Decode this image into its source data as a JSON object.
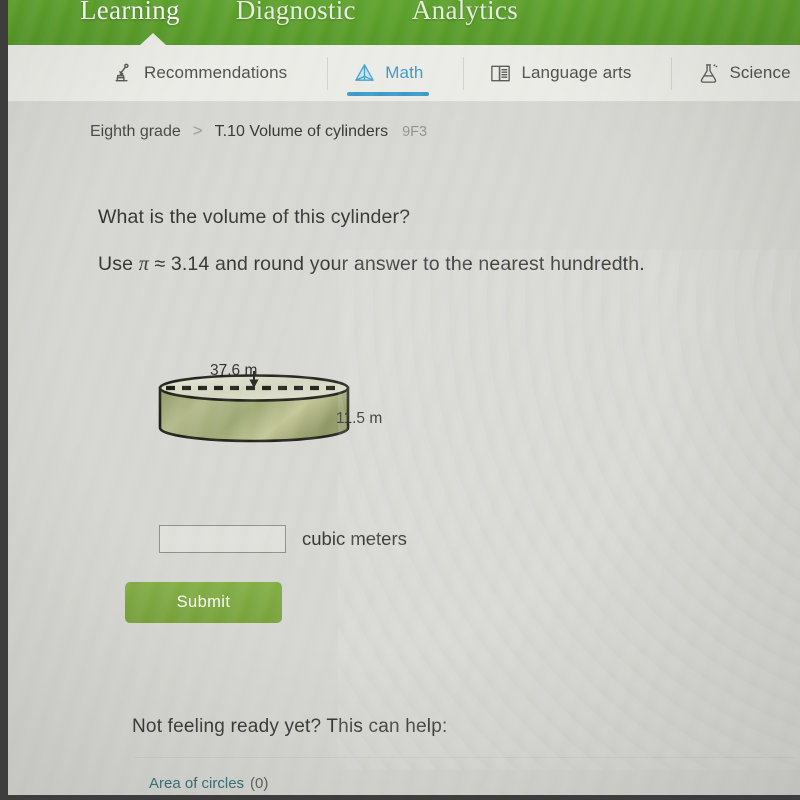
{
  "topnav": {
    "items": [
      {
        "label": "Learning",
        "active": true
      },
      {
        "label": "Diagnostic",
        "active": false
      },
      {
        "label": "Analytics",
        "active": false
      }
    ],
    "background_color": "#55a21c"
  },
  "tabs": [
    {
      "label": "Recommendations",
      "icon": "microscope-icon",
      "active": false
    },
    {
      "label": "Math",
      "icon": "pyramid-icon",
      "active": true
    },
    {
      "label": "Language arts",
      "icon": "open-book-icon",
      "active": false
    },
    {
      "label": "Science",
      "icon": "flask-icon",
      "active": false
    }
  ],
  "active_tab_color": "#2e9bd0",
  "breadcrumb": {
    "grade": "Eighth grade",
    "separator": ">",
    "skill": "T.10 Volume of cylinders",
    "code": "9F3"
  },
  "problem": {
    "question": "What is the volume of this cylinder?",
    "instruction_prefix": "Use ",
    "instruction_pi": "π",
    "instruction_suffix": " ≈ 3.14 and round your answer to the nearest hundredth."
  },
  "figure": {
    "shape": "cylinder",
    "diameter_label": "37.6 m",
    "height_label": "11.5 m",
    "body_color": "#9aa36a",
    "outline_color": "#15150f"
  },
  "answer": {
    "value": "",
    "placeholder": "",
    "unit": "cubic meters"
  },
  "submit": {
    "label": "Submit",
    "color": "#7aab35"
  },
  "help": {
    "heading": "Not feeling ready yet? This can help:",
    "links": [
      {
        "label": "Area of circles",
        "count": "(0)"
      }
    ],
    "link_color": "#2c6c78"
  }
}
